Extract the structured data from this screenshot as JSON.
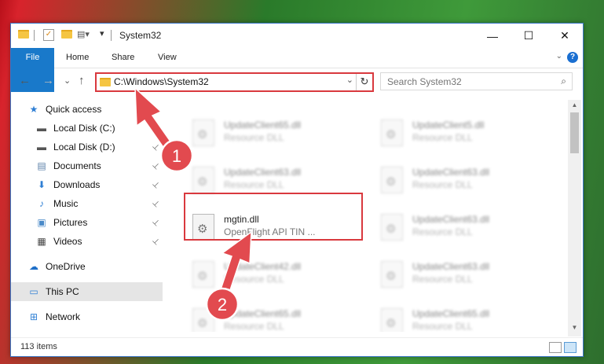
{
  "window": {
    "title": "System32",
    "controls": {
      "minimize": "—",
      "maximize": "☐",
      "close": "✕"
    }
  },
  "ribbon": {
    "tabs": [
      "File",
      "Home",
      "Share",
      "View"
    ],
    "help": "?",
    "expand": "⌄"
  },
  "nav": {
    "back": "←",
    "forward": "→",
    "recent": "⌄",
    "up": "↑",
    "address": "C:\\Windows\\System32",
    "address_dropdown": "⌄",
    "refresh": "↻",
    "search_placeholder": "Search System32",
    "search_icon": "⌕"
  },
  "sidebar": {
    "items": [
      {
        "label": "Quick access",
        "icon": "star-icon",
        "glyph": "★",
        "color": "#2f7fd4"
      },
      {
        "label": "Local Disk (C:)",
        "icon": "drive-icon",
        "glyph": "▬",
        "color": "#555555",
        "pinned": true
      },
      {
        "label": "Local Disk (D:)",
        "icon": "drive-icon",
        "glyph": "▬",
        "color": "#555555",
        "pinned": true
      },
      {
        "label": "Documents",
        "icon": "documents-icon",
        "glyph": "▤",
        "color": "#5a7fa8",
        "pinned": true
      },
      {
        "label": "Downloads",
        "icon": "downloads-icon",
        "glyph": "⬇",
        "color": "#2f7fd4",
        "pinned": true
      },
      {
        "label": "Music",
        "icon": "music-icon",
        "glyph": "♪",
        "color": "#2f7fd4",
        "pinned": true
      },
      {
        "label": "Pictures",
        "icon": "pictures-icon",
        "glyph": "▣",
        "color": "#4a8ac8",
        "pinned": true
      },
      {
        "label": "Videos",
        "icon": "videos-icon",
        "glyph": "▦",
        "color": "#444444",
        "pinned": true
      },
      {
        "label": "OneDrive",
        "icon": "cloud-icon",
        "glyph": "☁",
        "color": "#1e6fc8"
      },
      {
        "label": "This PC",
        "icon": "computer-icon",
        "glyph": "▭",
        "color": "#2f7fd4",
        "selected": true
      },
      {
        "label": "Network",
        "icon": "network-icon",
        "glyph": "⊞",
        "color": "#2f7fd4"
      }
    ],
    "pin_glyph": "📌"
  },
  "files": [
    {
      "name": "UpdateClient65.dll",
      "desc": "Resource DLL",
      "blurred": true
    },
    {
      "name": "UpdateClient5.dll",
      "desc": "Resource DLL",
      "blurred": true
    },
    {
      "name": "UpdateClient63.dll",
      "desc": "Resource DLL",
      "blurred": true
    },
    {
      "name": "UpdateClient63.dll",
      "desc": "Resource DLL",
      "blurred": true
    },
    {
      "name": "mgtin.dll",
      "desc": "OpenFlight API TIN ...",
      "blurred": false
    },
    {
      "name": "UpdateClient63.dll",
      "desc": "Resource DLL",
      "blurred": true
    },
    {
      "name": "UpdateClient42.dll",
      "desc": "Resource DLL",
      "blurred": true
    },
    {
      "name": "UpdateClient63.dll",
      "desc": "Resource DLL",
      "blurred": true
    },
    {
      "name": "UpdateClient65.dll",
      "desc": "Resource DLL",
      "blurred": true
    },
    {
      "name": "UpdateClient65.dll",
      "desc": "Resource DLL",
      "blurred": true
    }
  ],
  "status": {
    "item_count": "113 items"
  },
  "annotations": [
    {
      "number": "1",
      "color": "#e24a4f"
    },
    {
      "number": "2",
      "color": "#e24a4f"
    }
  ],
  "colors": {
    "accent": "#1979ca",
    "highlight": "#d9393e"
  }
}
